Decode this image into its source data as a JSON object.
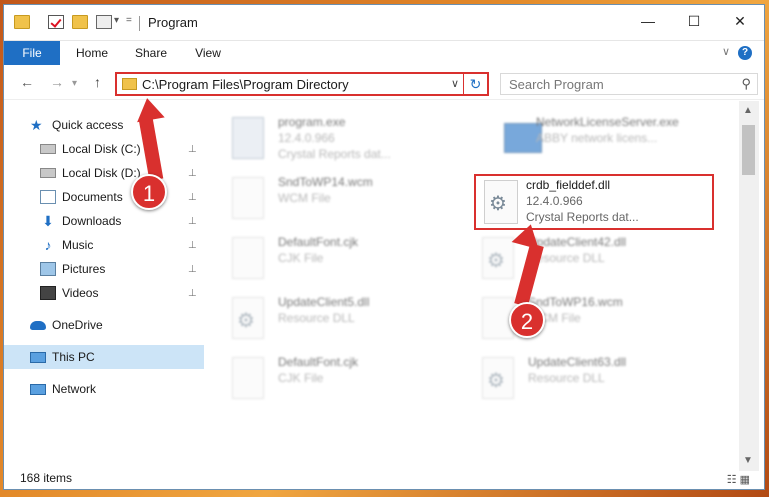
{
  "window": {
    "title": "Program",
    "controls": {
      "minimize": "—",
      "maximize": "☐",
      "close": "✕"
    }
  },
  "ribbon": {
    "tabs": [
      "File",
      "Home",
      "Share",
      "View"
    ],
    "help": "?"
  },
  "nav": {
    "back": "←",
    "forward": "→",
    "up": "↑",
    "dropdown": "∨",
    "refresh": "↻"
  },
  "address": {
    "path": "C:\\Program Files\\Program Directory"
  },
  "search": {
    "placeholder": "Search Program",
    "icon": "⚲"
  },
  "sidebar": {
    "items": [
      {
        "label": "Quick access",
        "icon": "star-icon",
        "pinned": false
      },
      {
        "label": "Local Disk (C:)",
        "icon": "drive-icon",
        "pinned": true
      },
      {
        "label": "Local Disk (D:)",
        "icon": "drive-icon",
        "pinned": true
      },
      {
        "label": "Documents",
        "icon": "documents-icon",
        "pinned": true
      },
      {
        "label": "Downloads",
        "icon": "download-icon",
        "pinned": true
      },
      {
        "label": "Music",
        "icon": "music-icon",
        "pinned": true
      },
      {
        "label": "Pictures",
        "icon": "pictures-icon",
        "pinned": true
      },
      {
        "label": "Videos",
        "icon": "videos-icon",
        "pinned": true
      },
      {
        "label": "OneDrive",
        "icon": "cloud-icon",
        "pinned": false
      },
      {
        "label": "This PC",
        "icon": "computer-icon",
        "pinned": false,
        "selected": true
      },
      {
        "label": "Network",
        "icon": "network-icon",
        "pinned": false
      }
    ],
    "pin_glyph": "⊥"
  },
  "files": [
    {
      "name": "program.exe",
      "line2": "12.4.0.966",
      "line3": "Crystal Reports dat..."
    },
    {
      "name": "NetworkLicenseServer.exe",
      "line2": "ABBY network licens...",
      "line3": ""
    },
    {
      "name": "SndToWP14.wcm",
      "line2": "WCM File",
      "line3": ""
    },
    {
      "name": "crdb_fielddef.dll",
      "line2": "12.4.0.966",
      "line3": "Crystal Reports dat..."
    },
    {
      "name": "DefaultFont.cjk",
      "line2": "CJK File",
      "line3": ""
    },
    {
      "name": "UpdateClient42.dll",
      "line2": "Resource DLL",
      "line3": ""
    },
    {
      "name": "UpdateClient5.dll",
      "line2": "Resource DLL",
      "line3": ""
    },
    {
      "name": "SndToWP16.wcm",
      "line2": "WCM File",
      "line3": ""
    },
    {
      "name": "DefaultFont.cjk",
      "line2": "CJK File",
      "line3": ""
    },
    {
      "name": "UpdateClient63.dll",
      "line2": "Resource DLL",
      "line3": ""
    }
  ],
  "status": {
    "count": "168 items",
    "view_icons": "☷ ▦"
  },
  "annotations": {
    "badge1": "1",
    "badge2": "2",
    "color": "#d9302e"
  }
}
